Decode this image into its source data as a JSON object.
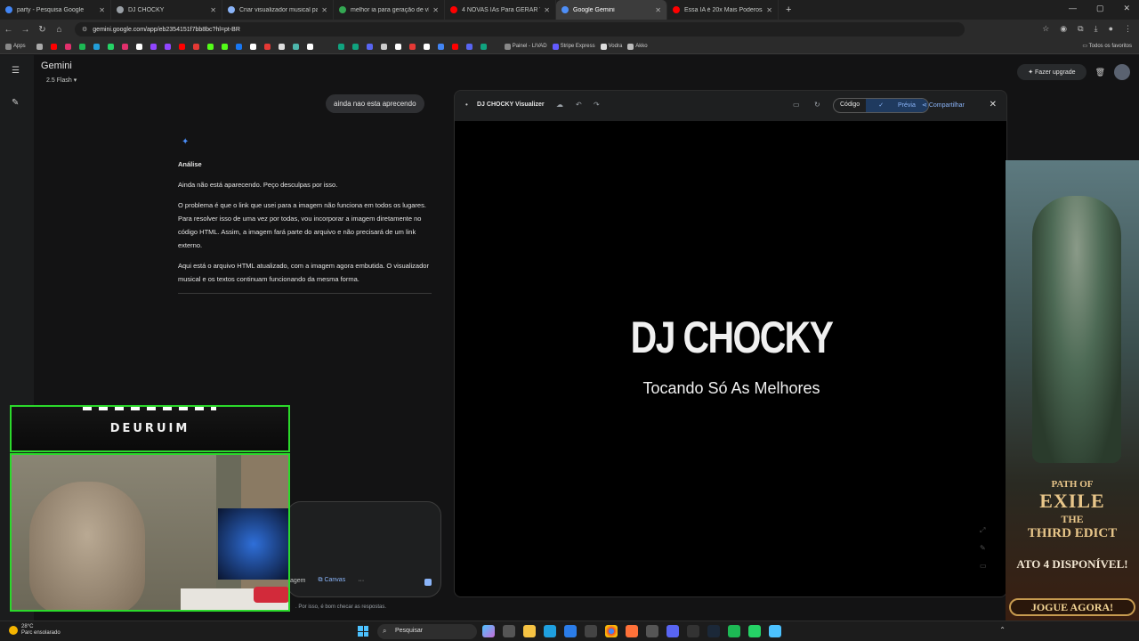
{
  "browser": {
    "tabs": [
      {
        "title": "party - Pesquisa Google",
        "color": "#4285f4"
      },
      {
        "title": "DJ CHOCKY",
        "color": "#9aa0a6"
      },
      {
        "title": "Criar visualizador musical para",
        "color": "#8ab4f8"
      },
      {
        "title": "melhor ia para geração de víde",
        "color": "#34a853"
      },
      {
        "title": "4 NOVAS IAs Para GERAR VÍDE",
        "color": "#ff0000"
      },
      {
        "title": "Google Gemini",
        "color": "#4e8ff8",
        "active": true
      },
      {
        "title": "Essa IA é 20x Mais Poderosa qu",
        "color": "#ff0000"
      }
    ],
    "url": "gemini.google.com/app/eb2354151f7bb8bc?hl=pt-BR",
    "bookmarks": {
      "apps_label": "Apps",
      "items": [
        {
          "label": "Painel - LIVAD",
          "color": "#888"
        },
        {
          "label": "Stripe Express",
          "color": "#635bff"
        },
        {
          "label": "Vodra",
          "color": "#ddd"
        },
        {
          "label": "Akko",
          "color": "#bbb"
        }
      ],
      "all_favorites": "Todos os favoritos"
    }
  },
  "gemini": {
    "title": "Gemini",
    "model": "2.5 Flash",
    "upgrade_label": "Fazer upgrade",
    "user_message": "ainda nao esta aprecendo",
    "response": {
      "heading": "Análise",
      "paragraphs": [
        "Ainda não está aparecendo. Peço desculpas por isso.",
        "O problema é que o link que usei para a imagem não funciona em todos os lugares. Para resolver isso de uma vez por todas, vou incorporar a imagem diretamente no código HTML. Assim, a imagem fará parte do arquivo e não precisará de um link externo.",
        "Aqui está o arquivo HTML atualizado, com a imagem agora embutida. O visualizador musical e os textos continuam funcionando da mesma forma."
      ]
    },
    "input_tools": {
      "image_label": "agem",
      "canvas_label": "Canvas",
      "more": "···"
    },
    "disclaimer": ". Por isso, é bom checar as respostas."
  },
  "canvas": {
    "title": "DJ CHOCKY Visualizer",
    "code_label": "Código",
    "preview_label": "Prévia",
    "share_label": "Compartilhar",
    "preview": {
      "heading": "DJ CHOCKY",
      "subheading": "Tocando Só As Melhores"
    }
  },
  "ad": {
    "logo_line1": "PATH OF",
    "logo_line2": "EXILE",
    "logo_line3": "THE",
    "logo_line4": "THIRD EDICT",
    "availability": "ATO 4 DISPONÍVEL!",
    "cta": "JOGUE AGORA!"
  },
  "webcam": {
    "name": "DEURUIM"
  },
  "taskbar": {
    "temperature": "28°C",
    "weather": "Parc ensolarado",
    "search_placeholder": "Pesquisar"
  }
}
